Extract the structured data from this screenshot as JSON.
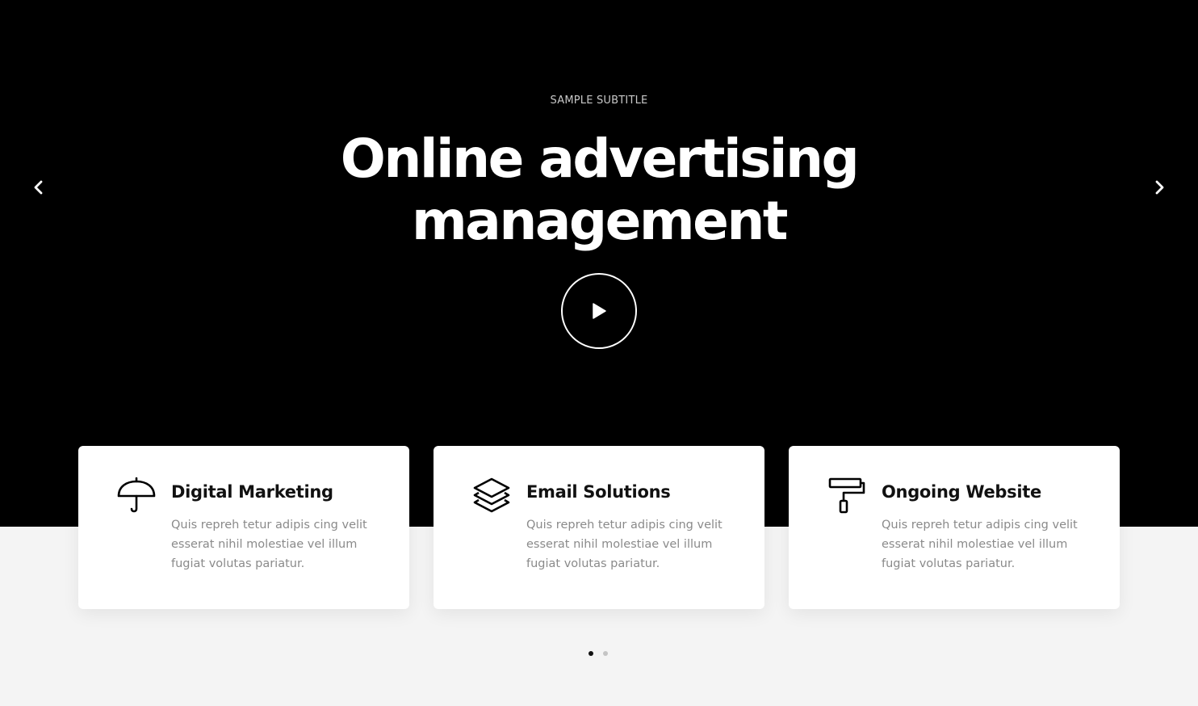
{
  "hero": {
    "subtitle": "SAMPLE SUBTITLE",
    "title_line_1": "Online advertising",
    "title_line_2": "management",
    "prev_icon": "chevron-left-icon",
    "next_icon": "chevron-right-icon",
    "play_icon": "play-icon",
    "background_color": "#000000"
  },
  "services": [
    {
      "icon": "umbrella-icon",
      "title": "Digital Marketing",
      "text": "Quis repreh tetur adipis cing velit esserat nihil molestiae vel illum fugiat volutas pariatur."
    },
    {
      "icon": "layers-icon",
      "title": "Email Solutions",
      "text": "Quis repreh tetur adipis cing velit esserat nihil molestiae vel illum fugiat volutas pariatur."
    },
    {
      "icon": "paint-roller-icon",
      "title": "Ongoing Website",
      "text": "Quis repreh tetur adipis cing velit esserat nihil molestiae vel illum fugiat volutas pariatur."
    }
  ],
  "pagination": {
    "pages": 2,
    "active_page": 1
  }
}
